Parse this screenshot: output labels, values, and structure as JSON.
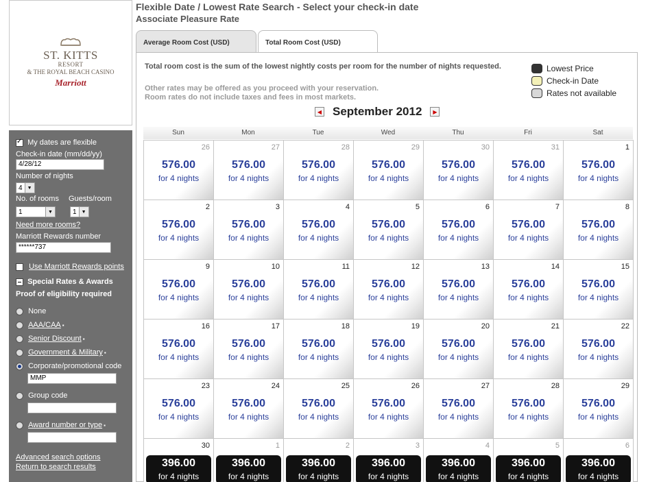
{
  "logo": {
    "line1": "ST. KITTS",
    "line2": "RESORT",
    "line3": "& THE ROYAL BEACH CASINO",
    "brand": "Marriott"
  },
  "sidebar": {
    "flexible_label": "My dates are flexible",
    "checkin_label": "Check-in date (mm/dd/yy)",
    "checkin_value": "4/28/12",
    "nights_label": "Number of nights",
    "nights_value": "4",
    "rooms_label": "No. of rooms",
    "rooms_value": "1",
    "guests_label": "Guests/room",
    "guests_value": "1",
    "more_rooms": "Need more rooms?",
    "rewards_label": "Marriott Rewards number",
    "rewards_value": "******737",
    "use_points": "Use Marriott Rewards points",
    "special_rates": "Special Rates & Awards",
    "proof": "Proof of eligibility required",
    "options": [
      {
        "label": "None",
        "link": false
      },
      {
        "label": "AAA/CAA",
        "link": true
      },
      {
        "label": "Senior Discount",
        "link": true
      },
      {
        "label": "Government & Military",
        "link": true
      },
      {
        "label": "Corporate/promotional code",
        "link": false
      },
      {
        "label": "Group code",
        "link": false
      },
      {
        "label": "Award number or type",
        "link": true
      }
    ],
    "corp_code_value": "MMP",
    "advanced": "Advanced search options",
    "return": "Return to search results"
  },
  "main": {
    "title": "Flexible Date / Lowest Rate Search - Select your check-in date",
    "subtitle": "Associate Pleasure Rate",
    "tabs": [
      "Average Room Cost (USD)",
      "Total Room Cost (USD)"
    ],
    "info_line1": "Total room cost is the sum of the lowest nightly costs per room for the number of nights requested.",
    "info_line2": "Other rates may be offered as you proceed with your reservation.",
    "info_line3": "Room rates do not include taxes and fees in most markets.",
    "legend": [
      {
        "label": "Lowest Price",
        "color": "#333333"
      },
      {
        "label": "Check-in Date",
        "color": "#f4f1b8"
      },
      {
        "label": "Rates not available",
        "color": "#d8d8d8"
      }
    ],
    "month": "September 2012",
    "dow": [
      "Sun",
      "Mon",
      "Tue",
      "Wed",
      "Thu",
      "Fri",
      "Sat"
    ],
    "days": [
      {
        "d": "26",
        "p": "576.00",
        "n": "for 4 nights",
        "other": true
      },
      {
        "d": "27",
        "p": "576.00",
        "n": "for 4 nights",
        "other": true
      },
      {
        "d": "28",
        "p": "576.00",
        "n": "for 4 nights",
        "other": true
      },
      {
        "d": "29",
        "p": "576.00",
        "n": "for 4 nights",
        "other": true
      },
      {
        "d": "30",
        "p": "576.00",
        "n": "for 4 nights",
        "other": true
      },
      {
        "d": "31",
        "p": "576.00",
        "n": "for 4 nights",
        "other": true
      },
      {
        "d": "1",
        "p": "576.00",
        "n": "for 4 nights"
      },
      {
        "d": "2",
        "p": "576.00",
        "n": "for 4 nights"
      },
      {
        "d": "3",
        "p": "576.00",
        "n": "for 4 nights"
      },
      {
        "d": "4",
        "p": "576.00",
        "n": "for 4 nights"
      },
      {
        "d": "5",
        "p": "576.00",
        "n": "for 4 nights"
      },
      {
        "d": "6",
        "p": "576.00",
        "n": "for 4 nights"
      },
      {
        "d": "7",
        "p": "576.00",
        "n": "for 4 nights"
      },
      {
        "d": "8",
        "p": "576.00",
        "n": "for 4 nights"
      },
      {
        "d": "9",
        "p": "576.00",
        "n": "for 4 nights"
      },
      {
        "d": "10",
        "p": "576.00",
        "n": "for 4 nights"
      },
      {
        "d": "11",
        "p": "576.00",
        "n": "for 4 nights"
      },
      {
        "d": "12",
        "p": "576.00",
        "n": "for 4 nights"
      },
      {
        "d": "13",
        "p": "576.00",
        "n": "for 4 nights"
      },
      {
        "d": "14",
        "p": "576.00",
        "n": "for 4 nights"
      },
      {
        "d": "15",
        "p": "576.00",
        "n": "for 4 nights"
      },
      {
        "d": "16",
        "p": "576.00",
        "n": "for 4 nights"
      },
      {
        "d": "17",
        "p": "576.00",
        "n": "for 4 nights"
      },
      {
        "d": "18",
        "p": "576.00",
        "n": "for 4 nights"
      },
      {
        "d": "19",
        "p": "576.00",
        "n": "for 4 nights"
      },
      {
        "d": "20",
        "p": "576.00",
        "n": "for 4 nights"
      },
      {
        "d": "21",
        "p": "576.00",
        "n": "for 4 nights"
      },
      {
        "d": "22",
        "p": "576.00",
        "n": "for 4 nights"
      },
      {
        "d": "23",
        "p": "576.00",
        "n": "for 4 nights"
      },
      {
        "d": "24",
        "p": "576.00",
        "n": "for 4 nights"
      },
      {
        "d": "25",
        "p": "576.00",
        "n": "for 4 nights"
      },
      {
        "d": "26",
        "p": "576.00",
        "n": "for 4 nights"
      },
      {
        "d": "27",
        "p": "576.00",
        "n": "for 4 nights"
      },
      {
        "d": "28",
        "p": "576.00",
        "n": "for 4 nights"
      },
      {
        "d": "29",
        "p": "576.00",
        "n": "for 4 nights"
      },
      {
        "d": "30",
        "p": "396.00",
        "n": "for 4 nights",
        "low": true
      },
      {
        "d": "1",
        "p": "396.00",
        "n": "for 4 nights",
        "low": true,
        "other": true
      },
      {
        "d": "2",
        "p": "396.00",
        "n": "for 4 nights",
        "low": true,
        "other": true
      },
      {
        "d": "3",
        "p": "396.00",
        "n": "for 4 nights",
        "low": true,
        "other": true
      },
      {
        "d": "4",
        "p": "396.00",
        "n": "for 4 nights",
        "low": true,
        "other": true
      },
      {
        "d": "5",
        "p": "396.00",
        "n": "for 4 nights",
        "low": true,
        "other": true
      },
      {
        "d": "6",
        "p": "396.00",
        "n": "for 4 nights",
        "low": true,
        "other": true
      }
    ]
  }
}
